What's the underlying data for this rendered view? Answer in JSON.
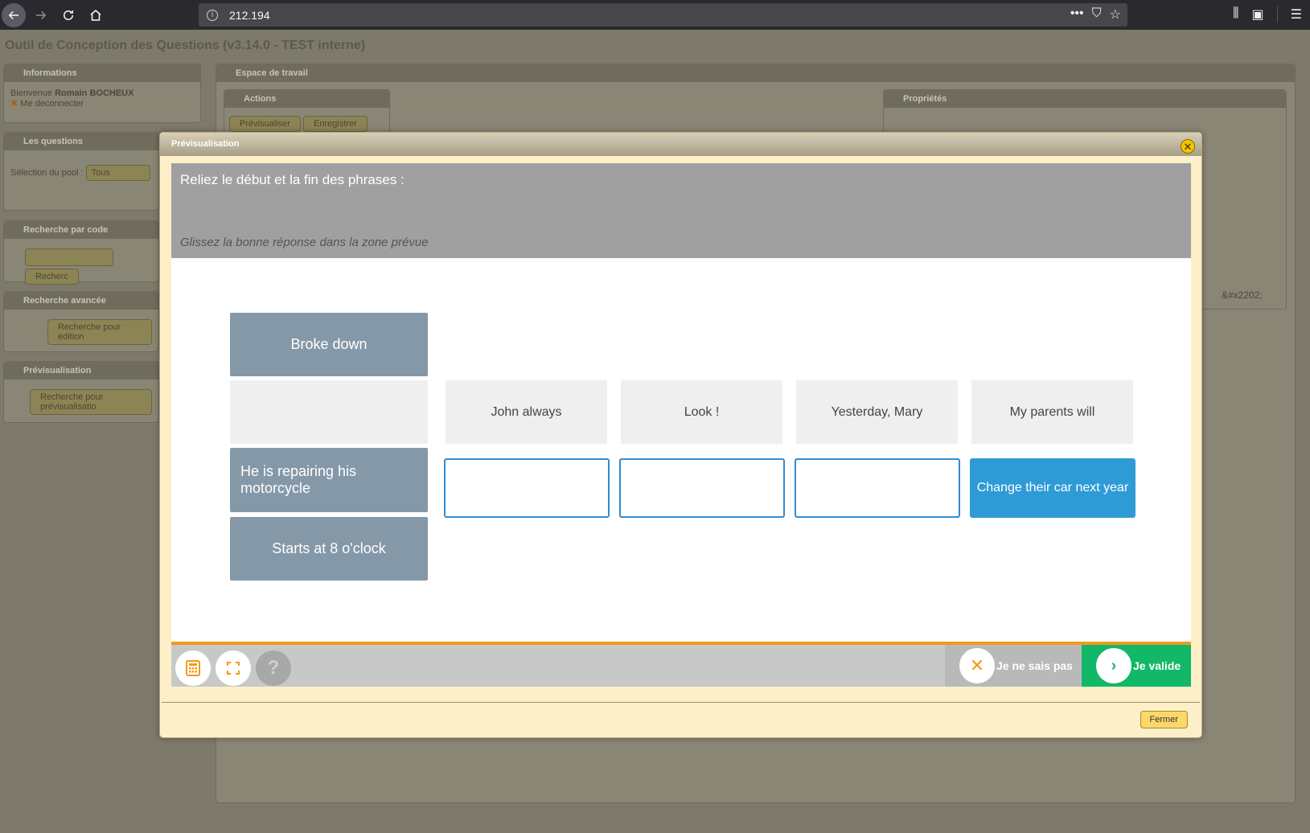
{
  "browser": {
    "url": "212.194"
  },
  "app": {
    "title": "Outil de Conception des Questions (v3.14.0 - TEST interne)",
    "panels": {
      "informations": {
        "title": "Informations",
        "welcome": "Bienvenue",
        "user": "Romain BOCHEUX",
        "logout": "Me deconnecter"
      },
      "questions": {
        "title": "Les questions",
        "pool_label": "Sélection du pool :",
        "pool_value": "Tous"
      },
      "code_search": {
        "title": "Recherche par code",
        "button": "Recherc"
      },
      "advanced_search": {
        "title": "Recherche avancée",
        "button": "Recherche pour édition"
      },
      "preview": {
        "title": "Prévisualisation",
        "button": "Recherche pour prévisualisatio"
      },
      "workspace": {
        "title": "Espace de travail"
      },
      "actions": {
        "title": "Actions",
        "preview_button": "Prévisualiser",
        "save_button": "Enregistrer"
      },
      "properties": {
        "title": "Propriétés",
        "trailing_text": "&#x2202;"
      }
    }
  },
  "modal": {
    "title": "Prévisualisation",
    "question": {
      "instruction": "Reliez le début et la fin des phrases :",
      "hint": "Glissez la bonne réponse dans la zone prévue"
    },
    "sources": [
      "Broke down",
      "He is repairing his motorcycle",
      "Starts at 8 o'clock"
    ],
    "beginnings": [
      "John always",
      "Look !",
      "Yesterday, Mary",
      "My parents will"
    ],
    "drop_filled": "Change their car next year",
    "footer": {
      "skip_label": "Je ne sais pas",
      "validate_label": "Je valide",
      "help_label": "?"
    },
    "close_button": "Fermer"
  }
}
